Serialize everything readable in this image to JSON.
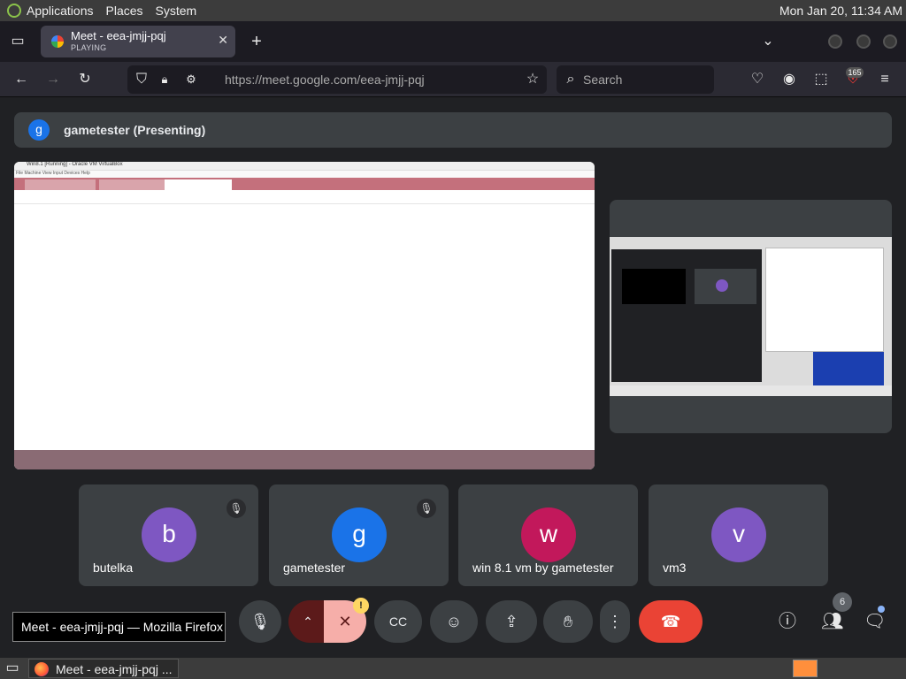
{
  "topbar": {
    "menu": [
      "Applications",
      "Places",
      "System"
    ],
    "clock": "Mon Jan 20, 11:34 AM"
  },
  "tab": {
    "title": "Meet - eea-jmjj-pqj",
    "subtitle": "PLAYING"
  },
  "navbar": {
    "url": "https://meet.google.com/eea-jmjj-pqj",
    "search_placeholder": "Search",
    "extension_badge": "165"
  },
  "presenting": {
    "avatar_letter": "g",
    "label": "gametester (Presenting)"
  },
  "shared_screen": {
    "window_title": "Win8.1 [Running] - Oracle VM VirtualBox",
    "menu_text": "File   Machine   View   Input   Devices   Help"
  },
  "participants": [
    {
      "letter": "b",
      "name": "butelka",
      "color": "#7e57c2",
      "muted": true
    },
    {
      "letter": "g",
      "name": "gametester",
      "color": "#1a73e8",
      "muted": true
    },
    {
      "letter": "w",
      "name": "win 8.1 vm by gametester",
      "color": "#c2185b",
      "muted": false
    },
    {
      "letter": "v",
      "name": "vm3",
      "color": "#7e57c2",
      "muted": false
    }
  ],
  "controls": {
    "tooltip": "Meet - eea-jmjj-pqj — Mozilla Firefox",
    "warning_badge": "!",
    "people_count": "6"
  },
  "taskbar": {
    "item": "Meet - eea-jmjj-pqj ..."
  },
  "colors": {
    "meet_bg": "#202124",
    "tile_bg": "#3c4043",
    "hangup": "#ea4335",
    "cam_off": "#f6aea9"
  }
}
